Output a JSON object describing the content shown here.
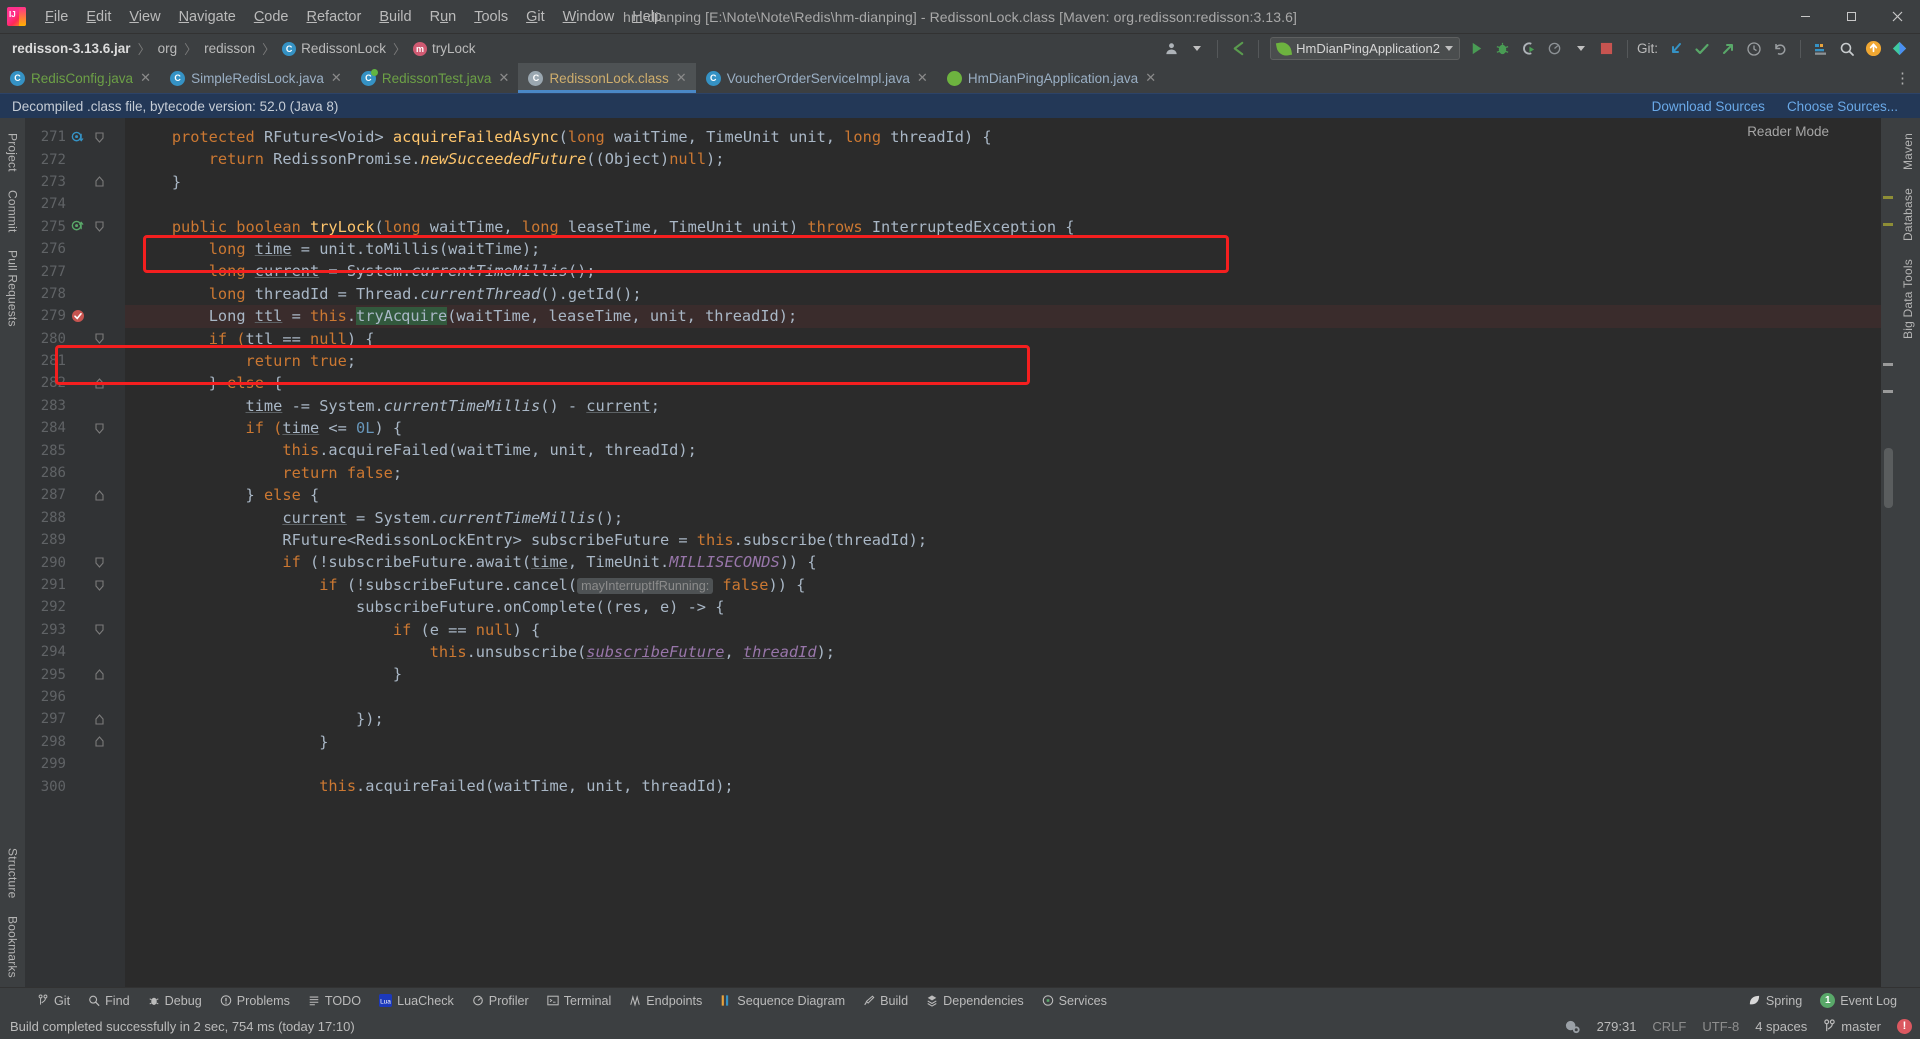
{
  "window": {
    "title": "hm-dianping [E:\\Note\\Note\\Redis\\hm-dianping] - RedissonLock.class [Maven: org.redisson:redisson:3.13.6]",
    "minimize": "—",
    "maximize": "❐",
    "close": "✕"
  },
  "menubar": [
    {
      "label": "File",
      "mnemonic": "F"
    },
    {
      "label": "Edit",
      "mnemonic": "E"
    },
    {
      "label": "View",
      "mnemonic": "V"
    },
    {
      "label": "Navigate",
      "mnemonic": "N"
    },
    {
      "label": "Code",
      "mnemonic": "C"
    },
    {
      "label": "Refactor",
      "mnemonic": "R"
    },
    {
      "label": "Build",
      "mnemonic": "B"
    },
    {
      "label": "Run",
      "mnemonic": "u"
    },
    {
      "label": "Tools",
      "mnemonic": "T"
    },
    {
      "label": "Git",
      "mnemonic": "G"
    },
    {
      "label": "Window",
      "mnemonic": "W"
    },
    {
      "label": "Help",
      "mnemonic": "H"
    }
  ],
  "breadcrumbs": [
    {
      "label": "redisson-3.13.6.jar",
      "icon": "jar-icon"
    },
    {
      "label": "org",
      "icon": "folder-icon"
    },
    {
      "label": "redisson",
      "icon": "folder-icon"
    },
    {
      "label": "RedissonLock",
      "icon": "class-icon"
    },
    {
      "label": "tryLock",
      "icon": "method-icon"
    }
  ],
  "toolbar": {
    "run_config": "HmDianPingApplication2",
    "git_label": "Git:",
    "icons": [
      "user-icon",
      "back-arrow-icon",
      "run-icon",
      "debug-icon",
      "run-with-coverage-icon",
      "profiler-icon",
      "stop-icon",
      "update-project-icon",
      "commit-icon",
      "push-icon",
      "history-icon",
      "rollback-icon",
      "layout-icon",
      "search-everywhere-icon",
      "notifications-icon",
      "theme-icon"
    ]
  },
  "tabs": [
    {
      "label": "RedisConfig.java",
      "icon": "java-class-icon",
      "active": false,
      "style": "green"
    },
    {
      "label": "SimpleRedisLock.java",
      "icon": "java-class-icon",
      "active": false,
      "style": "blue"
    },
    {
      "label": "RedissonTest.java",
      "icon": "java-test-icon",
      "active": false,
      "style": "green"
    },
    {
      "label": "RedissonLock.class",
      "icon": "class-file-icon",
      "active": true,
      "style": "gold"
    },
    {
      "label": "VoucherOrderServiceImpl.java",
      "icon": "java-class-icon",
      "active": false,
      "style": "blue"
    },
    {
      "label": "HmDianPingApplication.java",
      "icon": "spring-boot-icon",
      "active": false,
      "style": "blue"
    }
  ],
  "notice": {
    "text": "Decompiled .class file, bytecode version: 52.0 (Java 8)",
    "links": [
      "Download Sources",
      "Choose Sources..."
    ]
  },
  "editor": {
    "reader_mode": "Reader Mode",
    "first_line": 271,
    "lines": [
      {
        "n": 271,
        "mark": "override-icon",
        "fold": "fold-open",
        "indent": 1,
        "tokens": [
          {
            "t": "protected ",
            "c": "kw"
          },
          {
            "t": "RFuture<Void> ",
            "c": ""
          },
          {
            "t": "acquireFailedAsync",
            "c": "mth"
          },
          {
            "t": "(",
            "c": ""
          },
          {
            "t": "long ",
            "c": "kw"
          },
          {
            "t": "waitTime, ",
            "c": ""
          },
          {
            "t": "TimeUnit unit, ",
            "c": ""
          },
          {
            "t": "long ",
            "c": "kw"
          },
          {
            "t": "threadId) {",
            "c": ""
          }
        ]
      },
      {
        "n": 272,
        "mark": "",
        "fold": "",
        "indent": 2,
        "tokens": [
          {
            "t": "return ",
            "c": "kw"
          },
          {
            "t": "RedissonPromise.",
            "c": ""
          },
          {
            "t": "newSucceededFuture",
            "c": "mthi"
          },
          {
            "t": "((Object)",
            "c": ""
          },
          {
            "t": "null",
            "c": "kw"
          },
          {
            "t": ");",
            "c": ""
          }
        ]
      },
      {
        "n": 273,
        "mark": "",
        "fold": "fold-end",
        "indent": 1,
        "tokens": [
          {
            "t": "}",
            "c": ""
          }
        ]
      },
      {
        "n": 274,
        "mark": "",
        "fold": "",
        "indent": 0,
        "tokens": []
      },
      {
        "n": 275,
        "mark": "implemented-icon",
        "fold": "fold-open",
        "indent": 1,
        "tokens": [
          {
            "t": "public boolean ",
            "c": "kw"
          },
          {
            "t": "tryLock",
            "c": "mth"
          },
          {
            "t": "(",
            "c": ""
          },
          {
            "t": "long ",
            "c": "kw"
          },
          {
            "t": "waitTime, ",
            "c": ""
          },
          {
            "t": "long ",
            "c": "kw"
          },
          {
            "t": "leaseTime, TimeUnit unit) ",
            "c": ""
          },
          {
            "t": "throws ",
            "c": "kw"
          },
          {
            "t": "InterruptedException {",
            "c": ""
          }
        ]
      },
      {
        "n": 276,
        "mark": "",
        "fold": "",
        "indent": 2,
        "tokens": [
          {
            "t": "long ",
            "c": "kw"
          },
          {
            "t": "time",
            "c": "und"
          },
          {
            "t": " = unit.toMillis(waitTime);",
            "c": ""
          }
        ]
      },
      {
        "n": 277,
        "mark": "",
        "fold": "",
        "indent": 2,
        "tokens": [
          {
            "t": "long ",
            "c": "kw"
          },
          {
            "t": "current",
            "c": "und"
          },
          {
            "t": " = System.",
            "c": ""
          },
          {
            "t": "currentTimeMillis",
            "c": "stat"
          },
          {
            "t": "();",
            "c": ""
          }
        ]
      },
      {
        "n": 278,
        "mark": "",
        "fold": "",
        "indent": 2,
        "tokens": [
          {
            "t": "long ",
            "c": "kw"
          },
          {
            "t": "threadId = Thread.",
            "c": ""
          },
          {
            "t": "currentThread",
            "c": "stat"
          },
          {
            "t": "().getId();",
            "c": ""
          }
        ]
      },
      {
        "n": 279,
        "mark": "breakpoint-icon",
        "fold": "",
        "indent": 2,
        "highlight": true,
        "tokens": [
          {
            "t": "Long ",
            "c": ""
          },
          {
            "t": "ttl",
            "c": "und"
          },
          {
            "t": " = ",
            "c": ""
          },
          {
            "t": "this",
            "c": "kw"
          },
          {
            "t": ".",
            "c": ""
          },
          {
            "t": "tryAcquire",
            "c": "sel"
          },
          {
            "t": "(waitTime, leaseTime, unit, threadId);",
            "c": ""
          }
        ]
      },
      {
        "n": 280,
        "mark": "",
        "fold": "fold-open",
        "indent": 2,
        "tokens": [
          {
            "t": "if (",
            "c": "kw"
          },
          {
            "t": "ttl",
            "c": "und"
          },
          {
            "t": " == ",
            "c": ""
          },
          {
            "t": "null",
            "c": "kw"
          },
          {
            "t": ") {",
            "c": ""
          }
        ]
      },
      {
        "n": 281,
        "mark": "",
        "fold": "",
        "indent": 3,
        "tokens": [
          {
            "t": "return true",
            "c": "kw"
          },
          {
            "t": ";",
            "c": ""
          }
        ]
      },
      {
        "n": 282,
        "mark": "",
        "fold": "fold-end",
        "indent": 2,
        "tokens": [
          {
            "t": "} ",
            "c": ""
          },
          {
            "t": "else ",
            "c": "kw"
          },
          {
            "t": "{",
            "c": ""
          }
        ]
      },
      {
        "n": 283,
        "mark": "",
        "fold": "",
        "indent": 3,
        "tokens": [
          {
            "t": "time",
            "c": "und"
          },
          {
            "t": " -= System.",
            "c": ""
          },
          {
            "t": "currentTimeMillis",
            "c": "stat"
          },
          {
            "t": "() - ",
            "c": ""
          },
          {
            "t": "current",
            "c": "und"
          },
          {
            "t": ";",
            "c": ""
          }
        ]
      },
      {
        "n": 284,
        "mark": "",
        "fold": "fold-open",
        "indent": 3,
        "tokens": [
          {
            "t": "if (",
            "c": "kw"
          },
          {
            "t": "time",
            "c": "und"
          },
          {
            "t": " <= ",
            "c": ""
          },
          {
            "t": "0L",
            "c": "num"
          },
          {
            "t": ") {",
            "c": ""
          }
        ]
      },
      {
        "n": 285,
        "mark": "",
        "fold": "",
        "indent": 4,
        "tokens": [
          {
            "t": "this",
            "c": "kw"
          },
          {
            "t": ".acquireFailed(waitTime, unit, threadId);",
            "c": ""
          }
        ]
      },
      {
        "n": 286,
        "mark": "",
        "fold": "",
        "indent": 4,
        "tokens": [
          {
            "t": "return false",
            "c": "kw"
          },
          {
            "t": ";",
            "c": ""
          }
        ]
      },
      {
        "n": 287,
        "mark": "",
        "fold": "fold-end",
        "indent": 3,
        "tokens": [
          {
            "t": "} ",
            "c": ""
          },
          {
            "t": "else ",
            "c": "kw"
          },
          {
            "t": "{",
            "c": ""
          }
        ]
      },
      {
        "n": 288,
        "mark": "",
        "fold": "",
        "indent": 4,
        "tokens": [
          {
            "t": "current",
            "c": "und"
          },
          {
            "t": " = System.",
            "c": ""
          },
          {
            "t": "currentTimeMillis",
            "c": "stat"
          },
          {
            "t": "();",
            "c": ""
          }
        ]
      },
      {
        "n": 289,
        "mark": "",
        "fold": "",
        "indent": 4,
        "tokens": [
          {
            "t": "RFuture<RedissonLockEntry> subscribeFuture = ",
            "c": ""
          },
          {
            "t": "this",
            "c": "kw"
          },
          {
            "t": ".subscribe(threadId);",
            "c": ""
          }
        ]
      },
      {
        "n": 290,
        "mark": "",
        "fold": "fold-open",
        "indent": 4,
        "tokens": [
          {
            "t": "if ",
            "c": "kw"
          },
          {
            "t": "(!subscribeFuture.await(",
            "c": ""
          },
          {
            "t": "time",
            "c": "und"
          },
          {
            "t": ", TimeUnit.",
            "c": ""
          },
          {
            "t": "MILLISECONDS",
            "c": "purple"
          },
          {
            "t": ")) {",
            "c": ""
          }
        ]
      },
      {
        "n": 291,
        "mark": "",
        "fold": "fold-open",
        "indent": 5,
        "tokens": [
          {
            "t": "if ",
            "c": "kw"
          },
          {
            "t": "(!subscribeFuture.cancel(",
            "c": ""
          },
          {
            "t": "mayInterruptIfRunning:",
            "c": "hint"
          },
          {
            "t": " ",
            "c": ""
          },
          {
            "t": "false",
            "c": "kw"
          },
          {
            "t": ")) {",
            "c": ""
          }
        ]
      },
      {
        "n": 292,
        "mark": "",
        "fold": "",
        "indent": 6,
        "tokens": [
          {
            "t": "subscribeFuture.onComplete((res, e) -> {",
            "c": ""
          }
        ]
      },
      {
        "n": 293,
        "mark": "",
        "fold": "fold-open",
        "indent": 7,
        "tokens": [
          {
            "t": "if ",
            "c": "kw"
          },
          {
            "t": "(e == ",
            "c": ""
          },
          {
            "t": "null",
            "c": "kw"
          },
          {
            "t": ") {",
            "c": ""
          }
        ]
      },
      {
        "n": 294,
        "mark": "",
        "fold": "",
        "indent": 8,
        "tokens": [
          {
            "t": "this",
            "c": "kw"
          },
          {
            "t": ".unsubscribe(",
            "c": ""
          },
          {
            "t": "subscribeFuture",
            "c": "undp"
          },
          {
            "t": ", ",
            "c": ""
          },
          {
            "t": "threadId",
            "c": "undp"
          },
          {
            "t": ");",
            "c": ""
          }
        ]
      },
      {
        "n": 295,
        "mark": "",
        "fold": "fold-end",
        "indent": 7,
        "tokens": [
          {
            "t": "}",
            "c": ""
          }
        ]
      },
      {
        "n": 296,
        "mark": "",
        "fold": "",
        "indent": 0,
        "tokens": []
      },
      {
        "n": 297,
        "mark": "",
        "fold": "fold-end",
        "indent": 6,
        "tokens": [
          {
            "t": "});",
            "c": ""
          }
        ]
      },
      {
        "n": 298,
        "mark": "",
        "fold": "fold-end",
        "indent": 5,
        "tokens": [
          {
            "t": "}",
            "c": ""
          }
        ]
      },
      {
        "n": 299,
        "mark": "",
        "fold": "",
        "indent": 0,
        "tokens": []
      },
      {
        "n": 300,
        "mark": "",
        "fold": "",
        "indent": 5,
        "tokens": [
          {
            "t": "this",
            "c": "kw"
          },
          {
            "t": ".acquireFailed(waitTime, unit, threadId);",
            "c": ""
          }
        ]
      }
    ]
  },
  "left_rail": [
    {
      "label": "Project",
      "name": "tool-project"
    },
    {
      "label": "Commit",
      "name": "tool-commit"
    },
    {
      "label": "Pull Requests",
      "name": "tool-pull-requests"
    },
    {
      "label": "Structure",
      "name": "tool-structure"
    },
    {
      "label": "Bookmarks",
      "name": "tool-bookmarks"
    }
  ],
  "right_rail": [
    {
      "label": "Maven",
      "name": "tool-maven"
    },
    {
      "label": "Database",
      "name": "tool-database"
    },
    {
      "label": "Big Data Tools",
      "name": "tool-big-data-tools"
    }
  ],
  "bottom_tools": [
    {
      "label": "Git",
      "icon": "git-branch-icon"
    },
    {
      "label": "Find",
      "icon": "search-icon"
    },
    {
      "label": "Debug",
      "icon": "bug-icon"
    },
    {
      "label": "Problems",
      "icon": "warning-icon"
    },
    {
      "label": "TODO",
      "icon": "list-icon"
    },
    {
      "label": "LuaCheck",
      "icon": "lua-icon"
    },
    {
      "label": "Profiler",
      "icon": "profiler-icon"
    },
    {
      "label": "Terminal",
      "icon": "terminal-icon"
    },
    {
      "label": "Endpoints",
      "icon": "endpoints-icon"
    },
    {
      "label": "Sequence Diagram",
      "icon": "sequence-diagram-icon"
    },
    {
      "label": "Build",
      "icon": "build-icon"
    },
    {
      "label": "Dependencies",
      "icon": "dependencies-icon"
    },
    {
      "label": "Services",
      "icon": "services-icon"
    }
  ],
  "bottom_tools_right": [
    {
      "label": "Spring",
      "icon": "spring-icon",
      "badge": ""
    },
    {
      "label": "Event Log",
      "icon": "event-log-icon",
      "badge": "1"
    }
  ],
  "statusbar": {
    "message": "Build completed successfully in 2 sec, 754 ms (today 17:10)",
    "position": "279:31",
    "line_separator": "CRLF",
    "encoding": "UTF-8",
    "indent": "4 spaces",
    "branch": "master"
  },
  "colors": {
    "accent": "#4a88c7",
    "error": "#db5860",
    "success": "#59a869",
    "annotation_box": "#f41f1f",
    "notice_bg": "#233857",
    "editor_bg": "#2b2b2b",
    "chrome_bg": "#3c3f41"
  }
}
